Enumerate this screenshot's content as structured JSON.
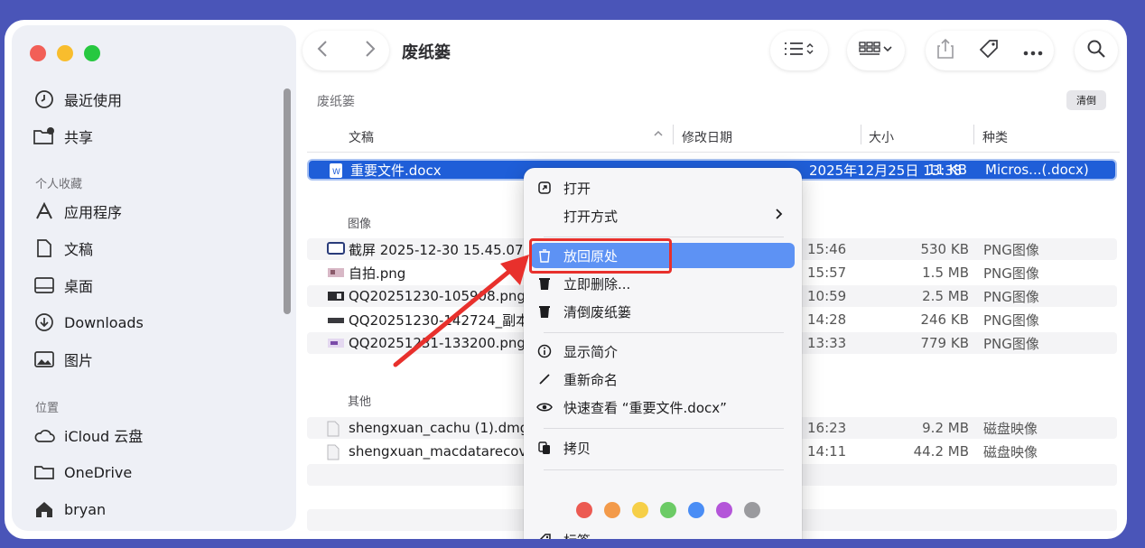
{
  "title": "废纸篓",
  "sidebar": {
    "items_top": [
      {
        "label": "最近使用",
        "icon": "clock-icon"
      },
      {
        "label": "共享",
        "icon": "shared-folder-icon"
      }
    ],
    "section_favorites": "个人收藏",
    "favorites": [
      {
        "label": "应用程序",
        "icon": "apps-icon"
      },
      {
        "label": "文稿",
        "icon": "document-icon"
      },
      {
        "label": "桌面",
        "icon": "desktop-icon"
      },
      {
        "label": "Downloads",
        "icon": "download-icon"
      },
      {
        "label": "图片",
        "icon": "photo-icon"
      }
    ],
    "section_locations": "位置",
    "locations": [
      {
        "label": "iCloud 云盘",
        "icon": "cloud-icon"
      },
      {
        "label": "OneDrive",
        "icon": "folder-icon"
      },
      {
        "label": "bryan",
        "icon": "home-icon"
      }
    ]
  },
  "main": {
    "path_label": "废纸篓",
    "empty_button": "清倒",
    "columns": {
      "name": "文稿",
      "date": "修改日期",
      "size": "大小",
      "kind": "种类"
    },
    "selected_file": {
      "name": "重要文件.docx",
      "date": "2025年12月25日 13:38",
      "size": "11 KB",
      "kind": "Micros...(.docx)"
    },
    "group_images": "图像",
    "images": [
      {
        "name": "截屏 2025-12-30 15.45.07",
        "date": "15:46",
        "size": "530 KB",
        "kind": "PNG图像"
      },
      {
        "name": "自拍.png",
        "date": "15:57",
        "size": "1.5 MB",
        "kind": "PNG图像"
      },
      {
        "name": "QQ20251230-105908.png",
        "date": "10:59",
        "size": "2.5 MB",
        "kind": "PNG图像"
      },
      {
        "name": "QQ20251230-142724_副本",
        "date": "14:28",
        "size": "246 KB",
        "kind": "PNG图像"
      },
      {
        "name": "QQ20251231-133200.png",
        "date": "13:33",
        "size": "779 KB",
        "kind": "PNG图像"
      }
    ],
    "group_other": "其他",
    "others": [
      {
        "name": "shengxuan_cachu (1).dmg",
        "date": "16:23",
        "size": "9.2 MB",
        "kind": "磁盘映像"
      },
      {
        "name": "shengxuan_macdatarecovery",
        "date": "14:11",
        "size": "44.2 MB",
        "kind": "磁盘映像"
      }
    ]
  },
  "context_menu": {
    "open": "打开",
    "open_with": "打开方式",
    "put_back": "放回原处",
    "delete_now": "立即删除...",
    "empty_trash": "清倒废纸篓",
    "get_info": "显示简介",
    "rename": "重新命名",
    "quick_look": "快速查看 “重要文件.docx”",
    "copy": "拷贝",
    "tags": "标签...",
    "tag_colors": [
      "#ec5a52",
      "#f39a4a",
      "#f6cf48",
      "#6ccb66",
      "#4a8df5",
      "#b455d9",
      "#9a9a9e"
    ]
  }
}
